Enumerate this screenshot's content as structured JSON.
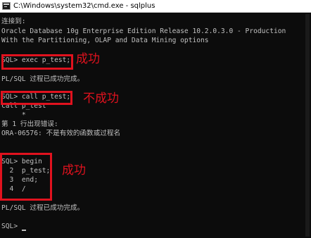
{
  "window": {
    "title": "C:\\Windows\\system32\\cmd.exe - sqlplus"
  },
  "icons": {
    "app": "console-app-icon"
  },
  "colors": {
    "background": "#0c0c0c",
    "text": "#c0c0c0",
    "annotation": "#e0121e"
  },
  "terminal": {
    "lines": [
      "连接到:",
      "Oracle Database 10g Enterprise Edition Release 10.2.0.3.0 - Production",
      "With the Partitioning, OLAP and Data Mining options",
      "SQL> exec p_test;",
      "PL/SQL 过程已成功完成。",
      "SQL> call p_test;",
      "call p_test",
      "     *",
      "第 1 行出现错误:",
      "ORA-06576: 不是有效的函数或过程名",
      "SQL> begin",
      "  2  p_test;",
      "  3  end;",
      "  4  /",
      "PL/SQL 过程已成功完成。",
      "SQL> "
    ]
  },
  "annotations": {
    "success_1": "成功",
    "failure": "不成功",
    "success_2": "成功"
  }
}
